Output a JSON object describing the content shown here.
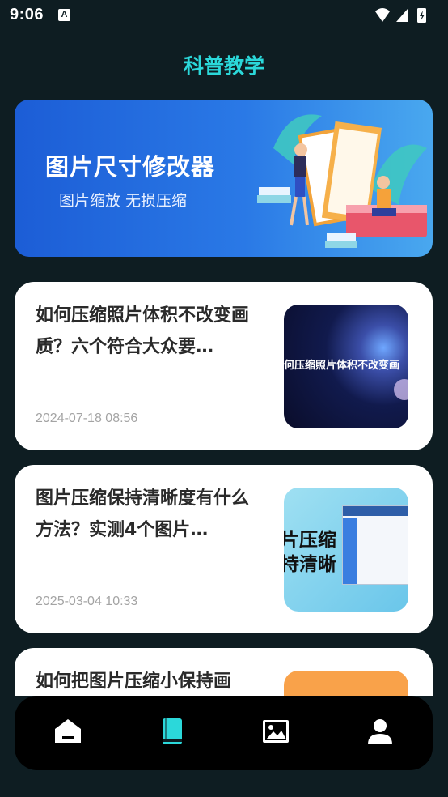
{
  "status_bar": {
    "time": "9:06",
    "notification_icon": "a-icon"
  },
  "page": {
    "title": "科普教学"
  },
  "banner": {
    "title": "图片尺寸修改器",
    "subtitle": "图片缩放 无损压缩"
  },
  "articles": [
    {
      "title": "如何压缩照片体积不改变画质？六个符合大众要…",
      "date": "2024-07-18 08:56",
      "thumb_text": "何压缩照片体积不改变画"
    },
    {
      "title": "图片压缩保持清晰度有什么方法？实测4个图片…",
      "date": "2025-03-04 10:33",
      "thumb_text": "片压缩\n持清晰"
    },
    {
      "title": "如何把图片压缩小保持画",
      "date": "",
      "thumb_text": ""
    }
  ],
  "bottom_nav": {
    "items": [
      {
        "name": "home",
        "icon": "home-icon",
        "active": false
      },
      {
        "name": "tutorial",
        "icon": "book-icon",
        "active": true
      },
      {
        "name": "image",
        "icon": "image-icon",
        "active": false
      },
      {
        "name": "profile",
        "icon": "user-icon",
        "active": false
      }
    ]
  },
  "colors": {
    "accent": "#2bd8da",
    "background": "#0e1d22",
    "card": "#ffffff",
    "nav": "#000000"
  }
}
